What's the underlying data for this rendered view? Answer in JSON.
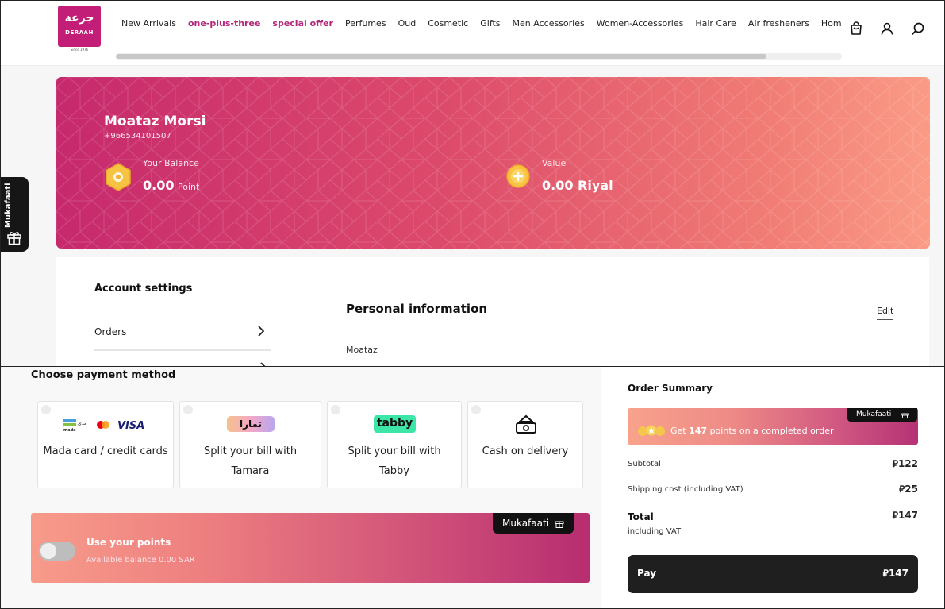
{
  "header": {
    "logo_text_ar": "جرعة",
    "logo_text_en": "DERAAH",
    "logo_since": "Since 1976",
    "nav": [
      "New Arrivals",
      "one-plus-three",
      "special offer",
      "Perfumes",
      "Oud",
      "Cosmetic",
      "Gifts",
      "Men Accessories",
      "Women-Accessories",
      "Hair Care",
      "Air fresheners",
      "Home"
    ],
    "highlighted_nav": [
      "one-plus-three",
      "special offer"
    ],
    "icons": [
      "cart-icon",
      "user-icon",
      "search-icon"
    ]
  },
  "rewards": {
    "name": "Moataz Morsi",
    "phone": "+966534101507",
    "balance_label": "Your Balance",
    "balance_value": "0.00",
    "balance_unit": "Point",
    "value_label": "Value",
    "value_amount": "0.00 Riyal"
  },
  "side_tab": {
    "label": "Mukafaati",
    "icon": "gift-icon"
  },
  "account": {
    "settings_title": "Account settings",
    "orders_label": "Orders",
    "personal_info_title": "Personal information",
    "edit_label": "Edit",
    "first_name": "Moataz"
  },
  "payment": {
    "title": "Choose payment method",
    "methods": [
      {
        "label": "Mada card / credit cards",
        "logos": [
          "mada",
          "mastercard",
          "VISA"
        ]
      },
      {
        "label": "Split your bill with Tamara",
        "logo": "تمارا"
      },
      {
        "label": "Split your bill with Tabby",
        "logo": "tabby"
      },
      {
        "label": "Cash on delivery",
        "icon": "cash-icon"
      }
    ],
    "points": {
      "badge": "Mukafaati",
      "title": "Use your points",
      "available": "Available balance 0.00 SAR",
      "toggle_on": false
    }
  },
  "summary": {
    "title": "Order Summary",
    "earn_badge": "Mukafaati",
    "earn_prefix": "Get",
    "earn_points": "147",
    "earn_suffix": "points on a completed order",
    "subtotal_label": "Subtotal",
    "subtotal_value": "122",
    "shipping_label": "Shipping cost (including VAT)",
    "shipping_value": "25",
    "total_label": "Total",
    "total_note": "including VAT",
    "total_value": "147",
    "pay_label": "Pay",
    "pay_amount": "147",
    "currency_symbol": "⃁"
  },
  "colors": {
    "brand": "#c21e78",
    "accent_text": "#b0267a",
    "banner_start": "#c6296d",
    "banner_end": "#fa9b86",
    "pay_button": "#1f1f1f"
  }
}
